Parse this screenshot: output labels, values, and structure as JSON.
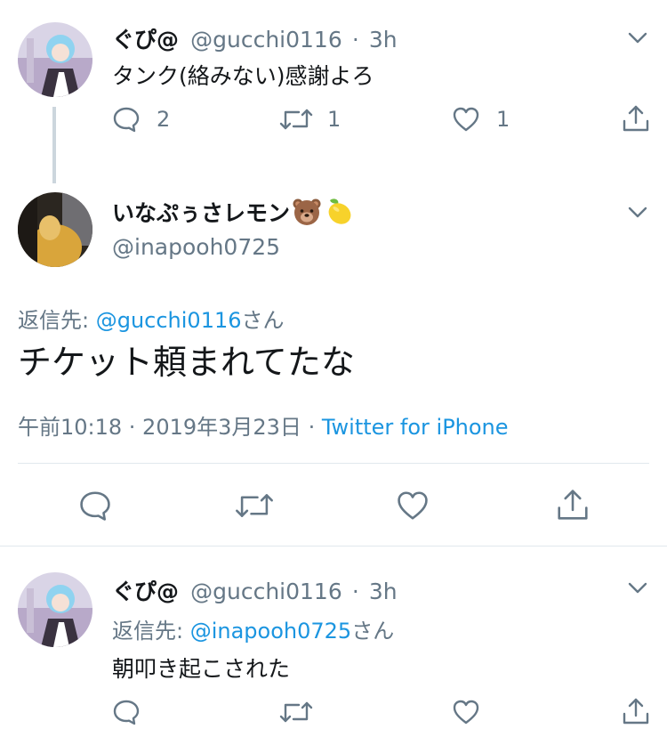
{
  "tweet1": {
    "name": "ぐぴ@",
    "handle": "@gucchi0116",
    "sep": "·",
    "time": "3h",
    "text": "タンク(絡みない)感謝よろ",
    "reply_count": "2",
    "retweet_count": "1",
    "like_count": "1"
  },
  "main": {
    "name": "いなぷぅさレモン",
    "emoji_bear": "bear-face-emoji",
    "emoji_lemon": "lemon-emoji",
    "handle": "@inapooh0725",
    "reply_to_label": "返信先: ",
    "reply_to_handle": "@gucchi0116",
    "reply_to_suffix": "さん",
    "text": "チケット頼まれてたな",
    "date_text": "午前10:18 · 2019年3月23日 · ",
    "source": "Twitter for iPhone"
  },
  "tweet3": {
    "name": "ぐぴ@",
    "handle": "@gucchi0116",
    "sep": "·",
    "time": "3h",
    "reply_to_label": "返信先: ",
    "reply_to_handle": "@inapooh0725",
    "reply_to_suffix": "さん",
    "text": "朝叩き起こされた"
  },
  "colors": {
    "text": "#14171a",
    "secondary": "#657786",
    "link": "#1b95e0",
    "divider": "#e1e8ed",
    "thread_line": "#ccd6dd"
  }
}
